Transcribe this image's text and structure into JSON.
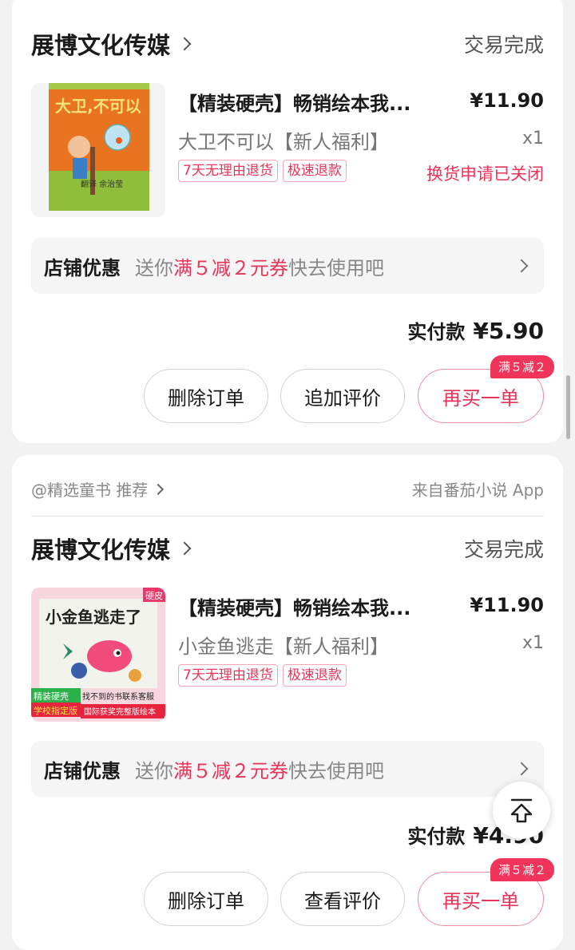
{
  "orders": [
    {
      "shop_name": "展博文化传媒",
      "status": "交易完成",
      "product_title": "【精装硬壳】畅销绘本我...",
      "price": "¥11.90",
      "variant": "大卫不可以【新人福利】",
      "quantity": "x1",
      "tags": [
        "7天无理由退货",
        "极速退款"
      ],
      "exchange_status": "换货申请已关闭",
      "promo": {
        "label": "店铺优惠",
        "pre": "送你",
        "highlight": "满５减２元券",
        "post": "快去使用吧"
      },
      "paid_label": "实付款",
      "paid_amount": "¥5.90",
      "buttons": {
        "delete": "删除订单",
        "review": "追加评价",
        "rebuy": "再买一单"
      },
      "rebuy_badge": "满５减２",
      "cover": {
        "title": "大卫，不可以",
        "colors": {
          "bg": "#e8741f",
          "band": "#8fbf3a"
        }
      }
    },
    {
      "recommendation": "@精选童书 推荐",
      "source": "来自番茄小说 App",
      "shop_name": "展博文化传媒",
      "status": "交易完成",
      "product_title": "【精装硬壳】畅销绘本我...",
      "price": "¥11.90",
      "variant": "小金鱼逃走【新人福利】",
      "quantity": "x1",
      "tags": [
        "7天无理由退货",
        "极速退款"
      ],
      "promo": {
        "label": "店铺优惠",
        "pre": "送你",
        "highlight": "满５减２元券",
        "post": "快去使用吧"
      },
      "paid_label": "实付款",
      "paid_amount": "¥4.90",
      "buttons": {
        "delete": "删除订单",
        "review": "查看评价",
        "rebuy": "再买一单"
      },
      "rebuy_badge": "满５减２",
      "cover": {
        "title": "小金鱼逃走了",
        "corner": "硬皮",
        "badge1": "精装硬壳",
        "badge2": "学校指定版",
        "caption": "找不到的书联系客服",
        "footer": "国际获奖完整版绘本"
      }
    }
  ],
  "accent_color": "#e8335a"
}
